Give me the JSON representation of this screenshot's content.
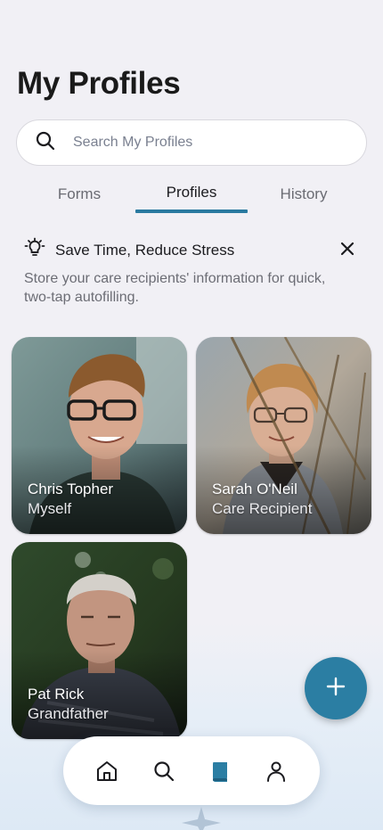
{
  "page": {
    "title": "My Profiles"
  },
  "search": {
    "placeholder": "Search My Profiles",
    "icon": "search-icon"
  },
  "tabs": [
    {
      "label": "Forms",
      "active": false
    },
    {
      "label": "Profiles",
      "active": true
    },
    {
      "label": "History",
      "active": false
    }
  ],
  "tip": {
    "icon": "lightbulb-icon",
    "title": "Save Time, Reduce Stress",
    "body": "Store your care recipients' information for quick, two-tap autofilling.",
    "close_icon": "close-icon"
  },
  "profiles": [
    {
      "name": "Chris Topher",
      "relation": "Myself"
    },
    {
      "name": "Sarah O'Neil",
      "relation": "Care Recipient"
    },
    {
      "name": "Pat Rick",
      "relation": "Grandfather"
    }
  ],
  "fab": {
    "icon": "plus-icon"
  },
  "nav": [
    {
      "name": "home",
      "icon": "home-icon",
      "active": false
    },
    {
      "name": "search",
      "icon": "search-icon",
      "active": false
    },
    {
      "name": "profiles",
      "icon": "book-icon",
      "active": true
    },
    {
      "name": "account",
      "icon": "person-icon",
      "active": false
    }
  ],
  "colors": {
    "accent": "#2b7ea3",
    "background": "#f1f0f5",
    "muted_text": "#6c6d75"
  }
}
